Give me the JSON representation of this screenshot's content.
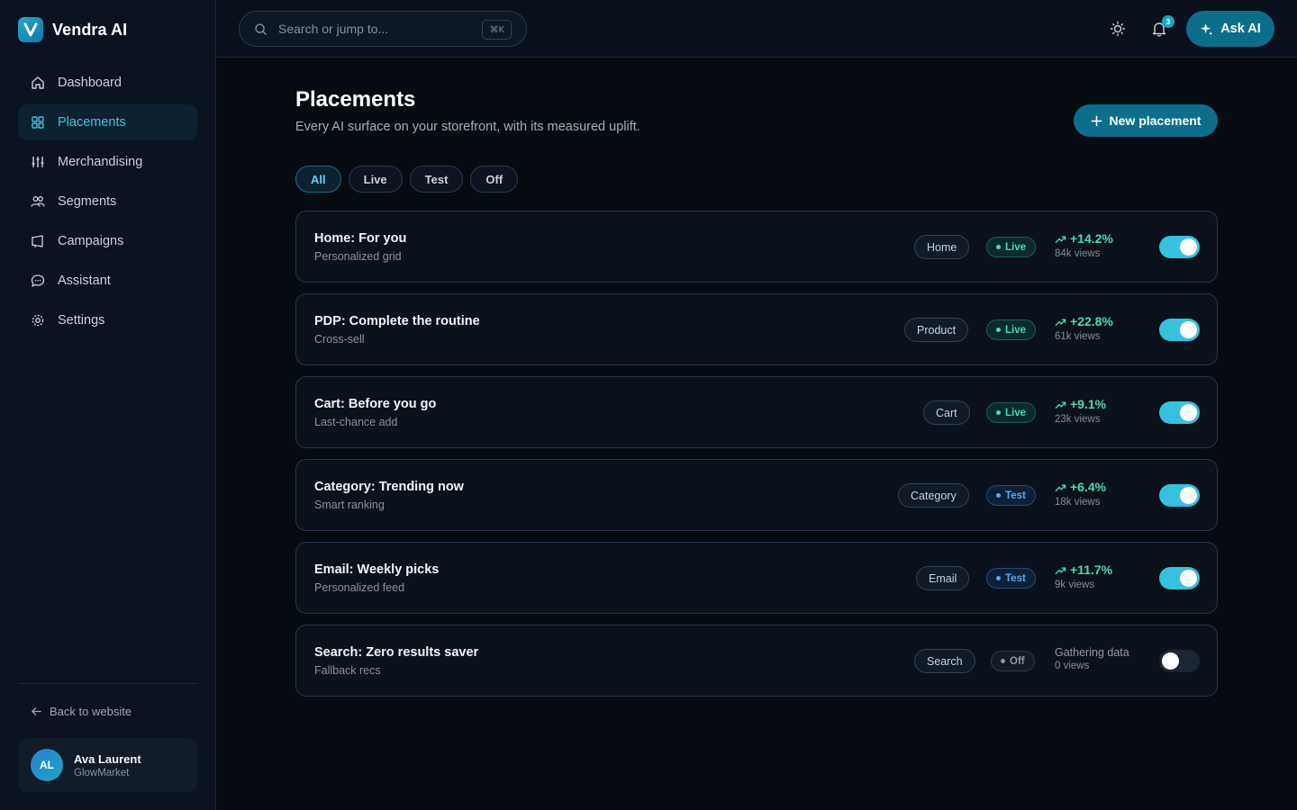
{
  "app": {
    "name": "Vendra AI"
  },
  "sidebar": {
    "items": [
      {
        "label": "Dashboard",
        "icon": "home-icon",
        "active": false
      },
      {
        "label": "Placements",
        "icon": "grid-icon",
        "active": true
      },
      {
        "label": "Merchandising",
        "icon": "sliders-icon",
        "active": false
      },
      {
        "label": "Segments",
        "icon": "users-icon",
        "active": false
      },
      {
        "label": "Campaigns",
        "icon": "megaphone-icon",
        "active": false
      },
      {
        "label": "Assistant",
        "icon": "chat-icon",
        "active": false
      },
      {
        "label": "Settings",
        "icon": "gear-icon",
        "active": false
      }
    ],
    "back_label": "Back to website",
    "user": {
      "initials": "AL",
      "name": "Ava Laurent",
      "org": "GlowMarket"
    }
  },
  "topbar": {
    "search_placeholder": "Search or jump to...",
    "shortcut": "⌘K",
    "notification_count": "3",
    "ask_label": "Ask AI"
  },
  "page": {
    "title": "Placements",
    "subtitle": "Every AI surface on your storefront, with its measured uplift.",
    "new_button": "New placement",
    "filters": [
      {
        "label": "All",
        "active": true
      },
      {
        "label": "Live",
        "active": false
      },
      {
        "label": "Test",
        "active": false
      },
      {
        "label": "Off",
        "active": false
      }
    ]
  },
  "placements": [
    {
      "title": "Home: For you",
      "subtitle": "Personalized grid",
      "tag": "Home",
      "status": "Live",
      "uplift": "+14.2%",
      "views": "84k views",
      "enabled": true
    },
    {
      "title": "PDP: Complete the routine",
      "subtitle": "Cross-sell",
      "tag": "Product",
      "status": "Live",
      "uplift": "+22.8%",
      "views": "61k views",
      "enabled": true
    },
    {
      "title": "Cart: Before you go",
      "subtitle": "Last-chance add",
      "tag": "Cart",
      "status": "Live",
      "uplift": "+9.1%",
      "views": "23k views",
      "enabled": true
    },
    {
      "title": "Category: Trending now",
      "subtitle": "Smart ranking",
      "tag": "Category",
      "status": "Test",
      "uplift": "+6.4%",
      "views": "18k views",
      "enabled": true
    },
    {
      "title": "Email: Weekly picks",
      "subtitle": "Personalized feed",
      "tag": "Email",
      "status": "Test",
      "uplift": "+11.7%",
      "views": "9k views",
      "enabled": true
    },
    {
      "title": "Search: Zero results saver",
      "subtitle": "Fallback recs",
      "tag": "Search",
      "status": "Off",
      "uplift": "Gathering data",
      "views": "0 views",
      "enabled": false
    }
  ],
  "colors": {
    "accent": "#36c1dd",
    "live": "#4fd6b4",
    "test": "#5aa6f0",
    "button": "#0d6e8c"
  }
}
